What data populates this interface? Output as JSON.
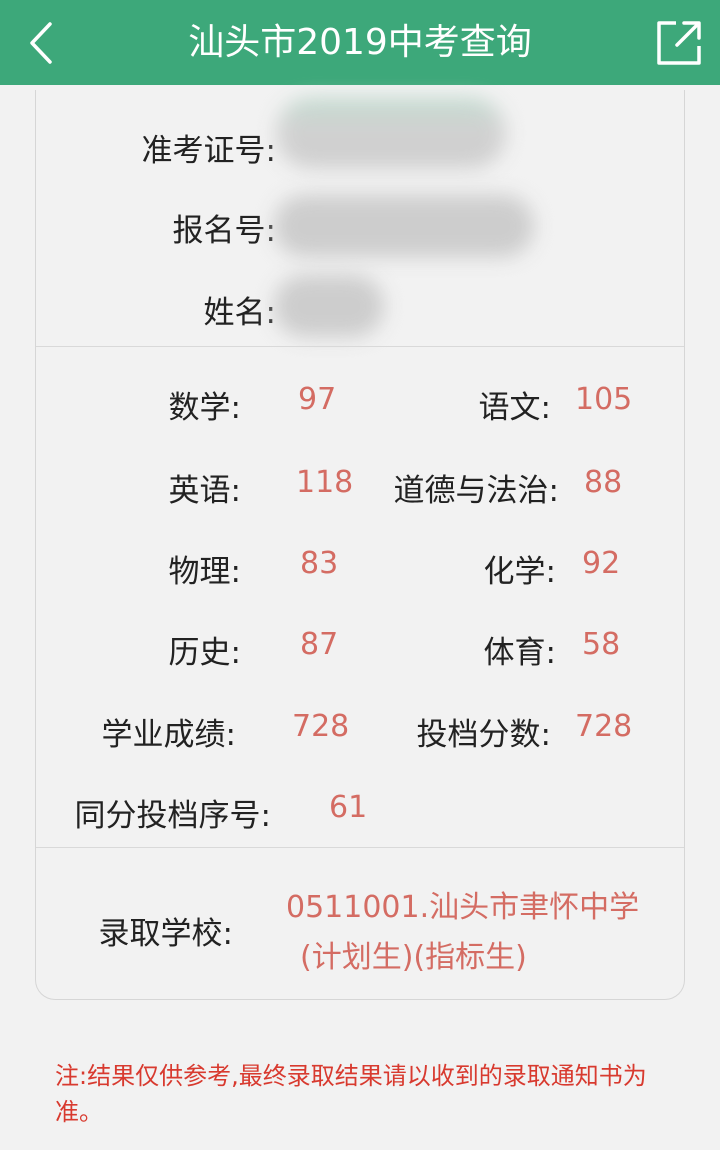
{
  "header": {
    "title": "汕头市2019中考查询"
  },
  "identity": {
    "exam_no_label": "准考证号:",
    "reg_no_label": "报名号:",
    "name_label": "姓名:"
  },
  "scores": {
    "math_label": "数学:",
    "math_value": "97",
    "chinese_label": "语文:",
    "chinese_value": "105",
    "english_label": "英语:",
    "english_value": "118",
    "ethics_label": "道德与法治:",
    "ethics_value": "88",
    "physics_label": "物理:",
    "physics_value": "83",
    "chemistry_label": "化学:",
    "chemistry_value": "92",
    "history_label": "历史:",
    "history_value": "87",
    "pe_label": "体育:",
    "pe_value": "58",
    "academic_label": "学业成绩:",
    "academic_value": "728",
    "filing_label": "投档分数:",
    "filing_value": "728",
    "rank_label": "同分投档序号:",
    "rank_value": "61"
  },
  "admission": {
    "school_label": "录取学校:",
    "school_line1": "0511001.汕头市聿怀中学",
    "school_line2": "(计划生)(指标生)"
  },
  "note": {
    "text": "注:结果仅供参考,最终录取结果请以收到的录取通知书为准。"
  },
  "colors": {
    "header_bg": "#3da87a",
    "value_text": "#d46c63",
    "note_text": "#d83a2f"
  }
}
